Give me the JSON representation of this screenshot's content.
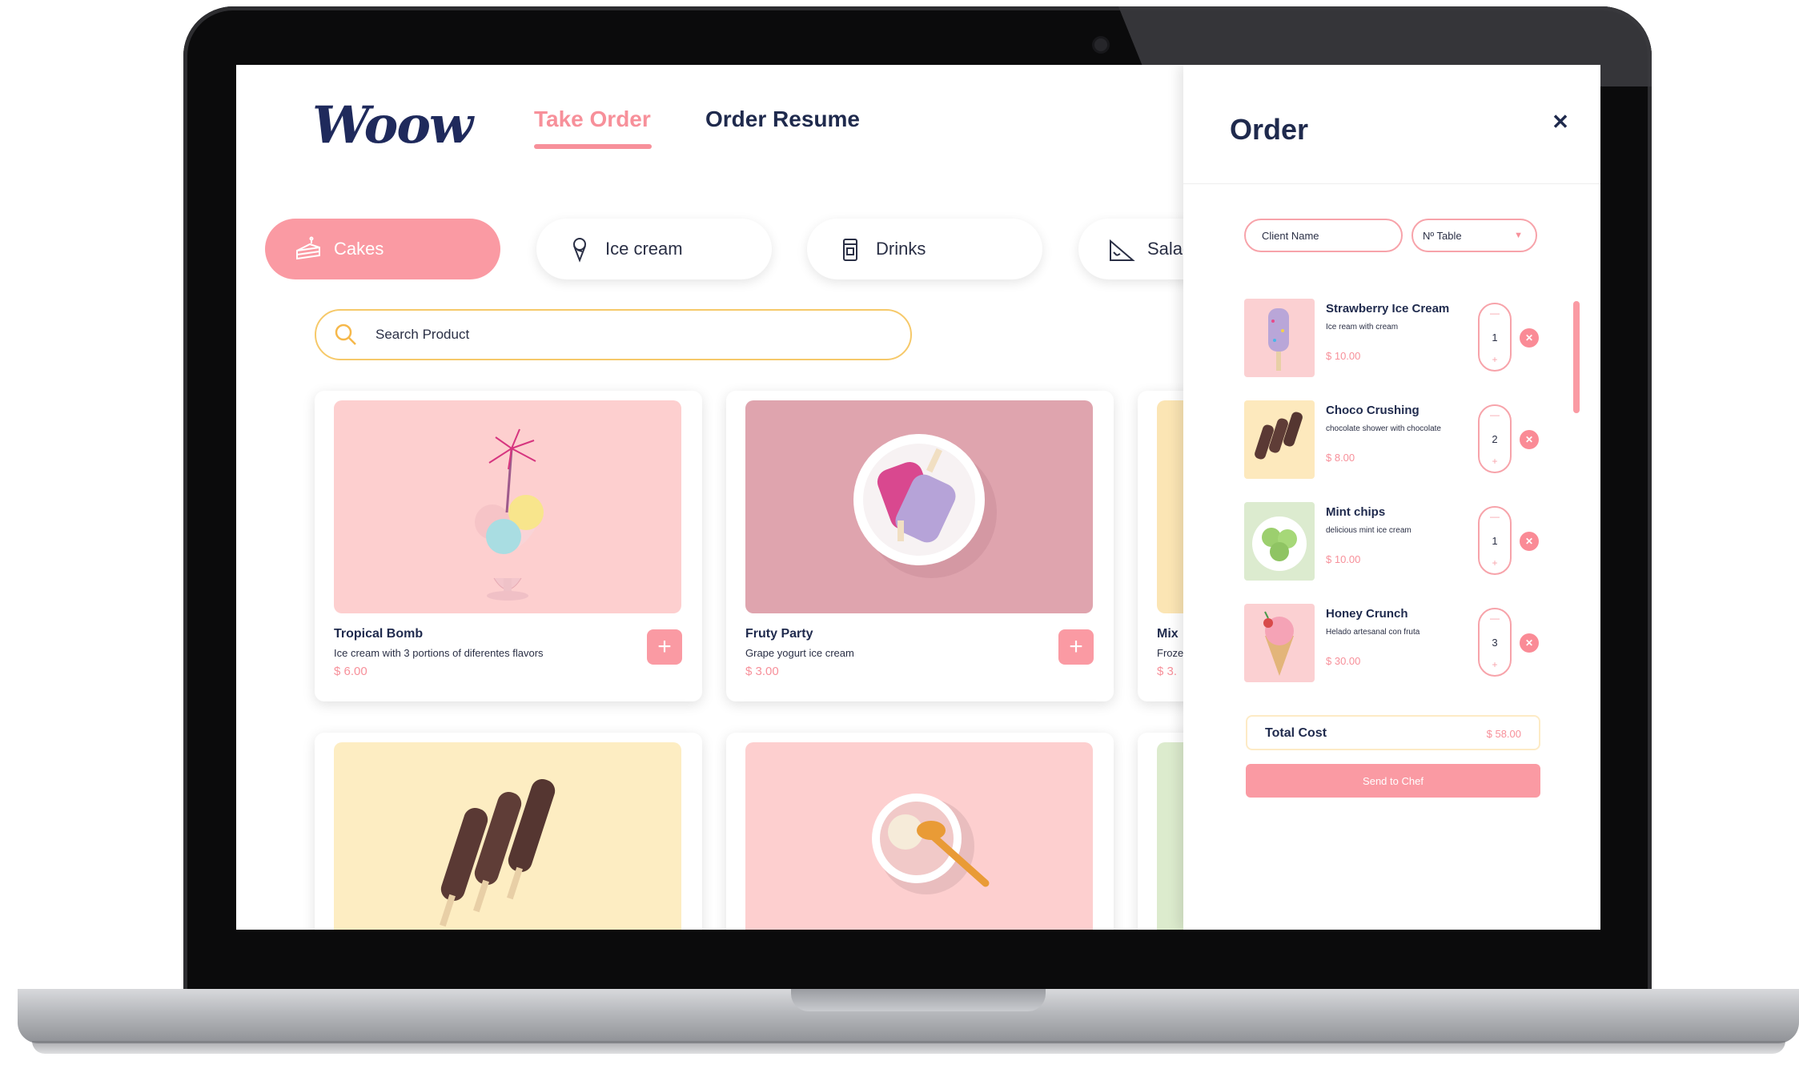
{
  "app": {
    "logo_text": "Woow"
  },
  "nav": {
    "take_order": "Take Order",
    "order_resume": "Order Resume"
  },
  "categories": [
    {
      "label": "Cakes",
      "icon": "cake-icon",
      "active": true
    },
    {
      "label": "Ice cream",
      "icon": "ice-cream-icon",
      "active": false
    },
    {
      "label": "Drinks",
      "icon": "drink-icon",
      "active": false
    },
    {
      "label": "Salad",
      "icon": "salad-icon",
      "active": false
    }
  ],
  "search": {
    "placeholder": "Search Product"
  },
  "products": [
    {
      "name": "Tropical Bomb",
      "description": "Ice cream with 3 portions of diferentes flavors",
      "price": "$ 6.00",
      "bg": "#fdcfcf"
    },
    {
      "name": "Fruty Party",
      "description": "Grape yogurt ice cream",
      "price": "$ 3.00",
      "bg": "#dfa4ae"
    },
    {
      "name": "Mix",
      "description": "Froze",
      "price": "$ 3.",
      "bg": "#fbe5b4"
    },
    {
      "name": "",
      "description": "",
      "price": "",
      "bg": "#fdedc2"
    },
    {
      "name": "",
      "description": "",
      "price": "",
      "bg": "#fdcfcf"
    },
    {
      "name": "",
      "description": "",
      "price": "",
      "bg": "#dcebcd"
    }
  ],
  "order": {
    "title": "Order",
    "close_icon": "close-icon",
    "client_name_placeholder": "Client Name",
    "table_select_value": "Nº Table",
    "items": [
      {
        "name": "Strawberry Ice Cream",
        "description": "Ice ream with cream",
        "price": "$ 10.00",
        "qty": "1",
        "bg": "#fbd0d2"
      },
      {
        "name": "Choco Crushing",
        "description": "chocolate shower with chocolate",
        "price": "$ 8.00",
        "qty": "2",
        "bg": "#fde9bd"
      },
      {
        "name": "Mint chips",
        "description": "delicious mint ice cream",
        "price": "$ 10.00",
        "qty": "1",
        "bg": "#dcebcf"
      },
      {
        "name": "Honey Crunch",
        "description": "Helado artesanal con fruta",
        "price": "$ 30.00",
        "qty": "3",
        "bg": "#fbd0d2"
      }
    ],
    "total_label": "Total Cost",
    "total_value": "$ 58.00",
    "send_label": "Send to Chef"
  },
  "colors": {
    "accent": "#fa9aa3",
    "navy": "#1f2a4d",
    "search_border": "#f6c96a"
  }
}
